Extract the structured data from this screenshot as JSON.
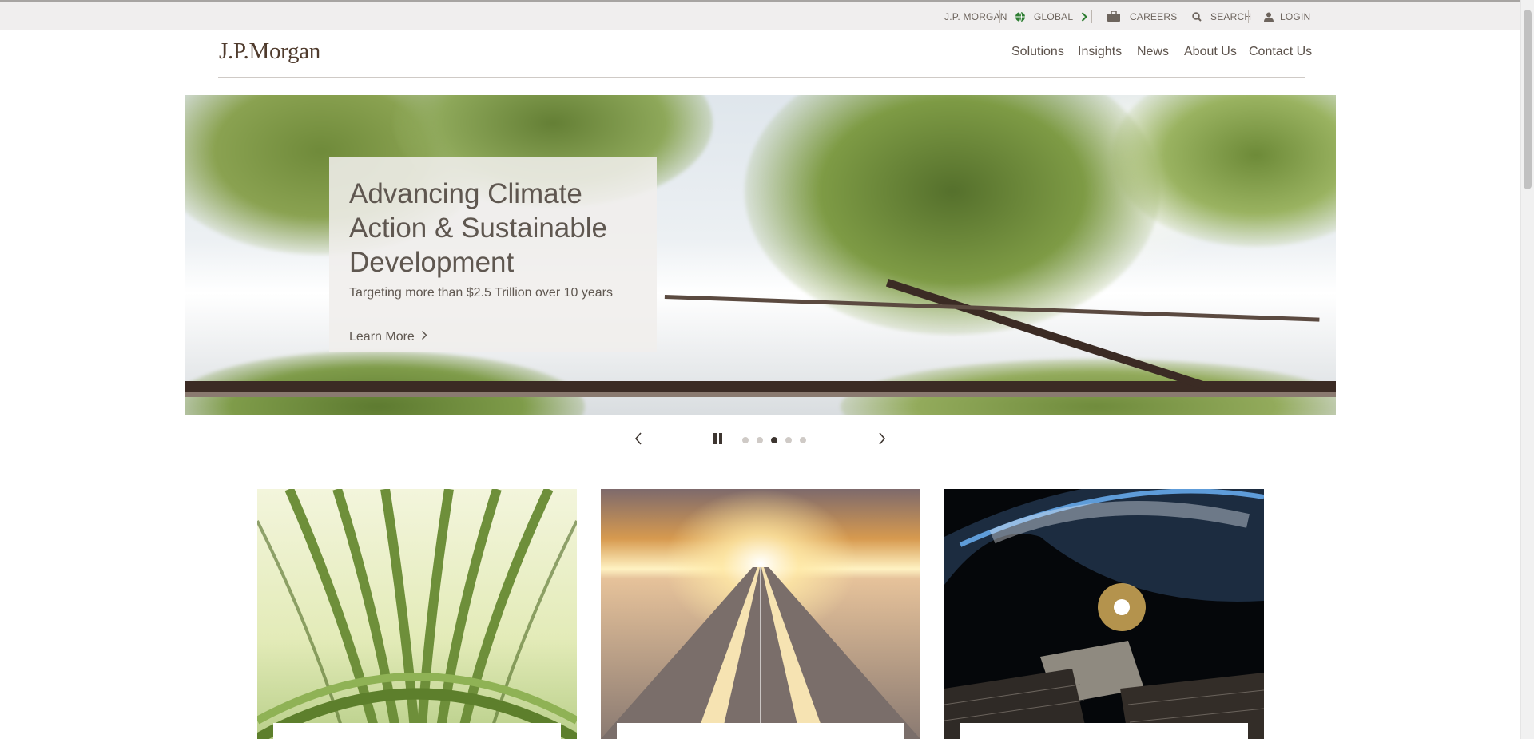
{
  "utility_nav": {
    "brand": "J.P. MORGAN",
    "region": "GLOBAL",
    "careers": "CAREERS",
    "search": "SEARCH",
    "login": "LOGIN"
  },
  "header": {
    "logo": "J.P.Morgan",
    "nav": [
      "Solutions",
      "Insights",
      "News",
      "About Us",
      "Contact Us"
    ]
  },
  "hero": {
    "title": "Advancing Climate Action & Sustainable Development",
    "subtitle": "Targeting more than $2.5 Trillion over 10 years",
    "cta": "Learn More"
  },
  "carousel": {
    "slide_count": 5,
    "active_index": 2
  },
  "cards": [
    {
      "image": "green-architecture-canopy"
    },
    {
      "image": "road-to-sunrise"
    },
    {
      "image": "satellite-over-earth"
    }
  ],
  "colors": {
    "brand_brown": "#4f3b2d",
    "accent_green": "#2e7d32",
    "text": "#5c524b"
  }
}
